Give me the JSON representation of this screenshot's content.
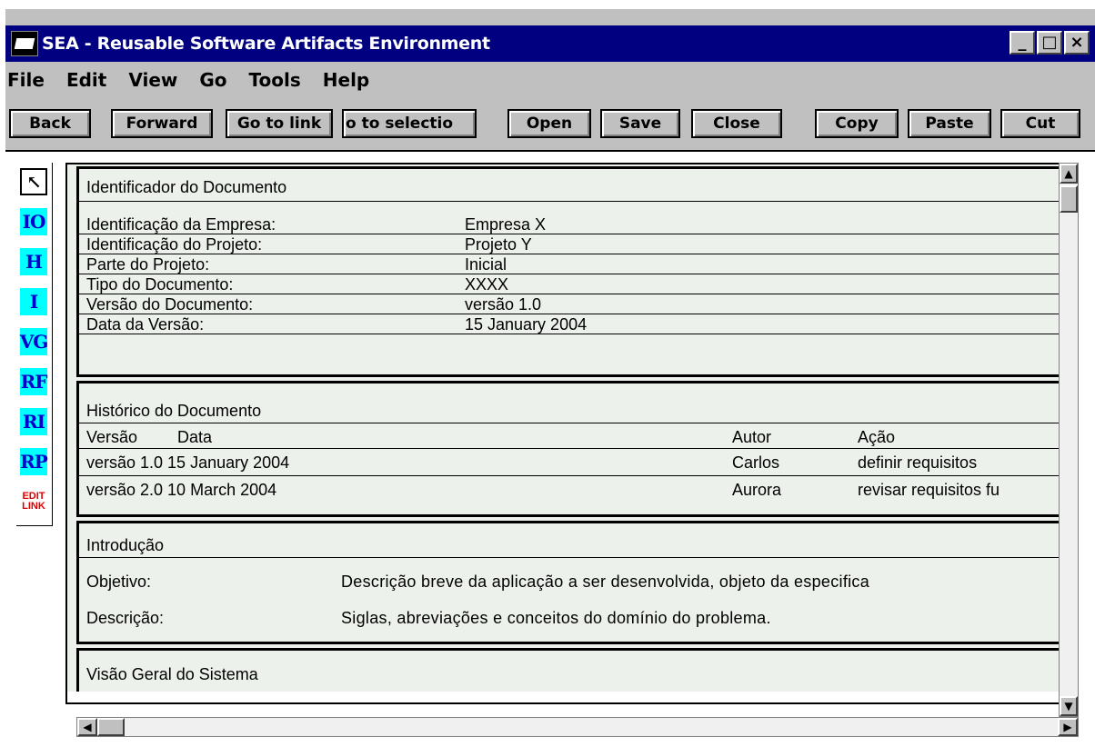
{
  "window": {
    "title": "SEA - Reusable Software Artifacts Environment",
    "minimize": "_",
    "maximize": "□",
    "close": "×"
  },
  "menu": [
    "File",
    "Edit",
    "View",
    "Go",
    "Tools",
    "Help"
  ],
  "toolbar": [
    "Back",
    "Forward",
    "Go to link",
    "o to selectio",
    "Open",
    "Save",
    "Close",
    "Copy",
    "Paste",
    "Cut"
  ],
  "palette": {
    "pointer": "↖",
    "items": [
      "IO",
      "H",
      "I",
      "VG",
      "RF",
      "RI",
      "RP"
    ],
    "edit_line1": "EDIT",
    "edit_line2": "LINK"
  },
  "doc": {
    "identificador": {
      "heading": "Identificador do Documento",
      "rows": [
        {
          "label": "Identificação da Empresa:",
          "value": "Empresa X"
        },
        {
          "label": "Identificação do Projeto:",
          "value": "Projeto Y"
        },
        {
          "label": "Parte do Projeto:",
          "value": "Inicial"
        },
        {
          "label": "Tipo do Documento:",
          "value": "XXXX"
        },
        {
          "label": "Versão do Documento:",
          "value": "versão 1.0"
        },
        {
          "label": "Data da Versão:",
          "value": "15 January 2004"
        }
      ]
    },
    "historico": {
      "heading": "Histórico do Documento",
      "columns": {
        "versao": "Versão",
        "data": "Data",
        "autor": "Autor",
        "acao": "Ação"
      },
      "rows": [
        {
          "versao_data": "versão 1.0 15 January 2004",
          "autor": "Carlos",
          "acao": "definir requisitos"
        },
        {
          "versao_data": "versão 2.0 10 March 2004",
          "autor": "Aurora",
          "acao": "revisar requisitos fu"
        }
      ]
    },
    "introducao": {
      "heading": "Introdução",
      "objetivo_label": "Objetivo:",
      "objetivo_value": "Descrição breve da aplicação a ser desenvolvida, objeto da especifica",
      "descricao_label": "Descrição:",
      "descricao_value": "Siglas, abreviações e conceitos do domínio do problema."
    },
    "visao": {
      "heading": "Visão Geral do Sistema"
    }
  },
  "scrollbars": {
    "up": "▲",
    "down": "▼",
    "left": "◀",
    "right": "▶"
  }
}
